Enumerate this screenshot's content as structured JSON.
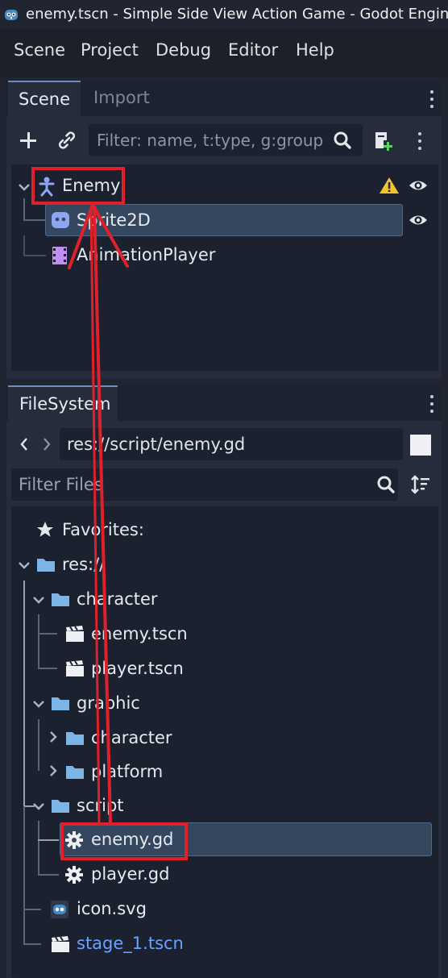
{
  "window": {
    "title": "enemy.tscn - Simple Side View Action Game - Godot Engine"
  },
  "menubar": {
    "items": [
      "Scene",
      "Project",
      "Debug",
      "Editor",
      "Help"
    ]
  },
  "scene_dock": {
    "tabs": [
      "Scene",
      "Import"
    ],
    "filter_placeholder": "Filter: name, t:type, g:group",
    "nodes": [
      {
        "label": "Enemy",
        "icon": "character-body-icon"
      },
      {
        "label": "Sprite2D",
        "icon": "sprite2d-icon"
      },
      {
        "label": "AnimationPlayer",
        "icon": "animation-player-icon"
      }
    ]
  },
  "filesystem_dock": {
    "tab": "FileSystem",
    "path": "res://script/enemy.gd",
    "filter_placeholder": "Filter Files",
    "tree": {
      "favorites": "Favorites:",
      "root": "res://",
      "character": "character",
      "enemy_tscn": "enemy.tscn",
      "player_tscn": "player.tscn",
      "graphic": "graphic",
      "graphic_character": "character",
      "platform": "platform",
      "script": "script",
      "enemy_gd": "enemy.gd",
      "player_gd": "player.gd",
      "icon_svg": "icon.svg",
      "stage_1": "stage_1.tscn"
    }
  },
  "colors": {
    "background": "#202531",
    "panel": "#262c3b",
    "selection": "#35475f",
    "accent_blue": "#6aa3ff",
    "annotation_red": "#e0202a",
    "warning": "#f2c230",
    "folder": "#7db4e6"
  }
}
